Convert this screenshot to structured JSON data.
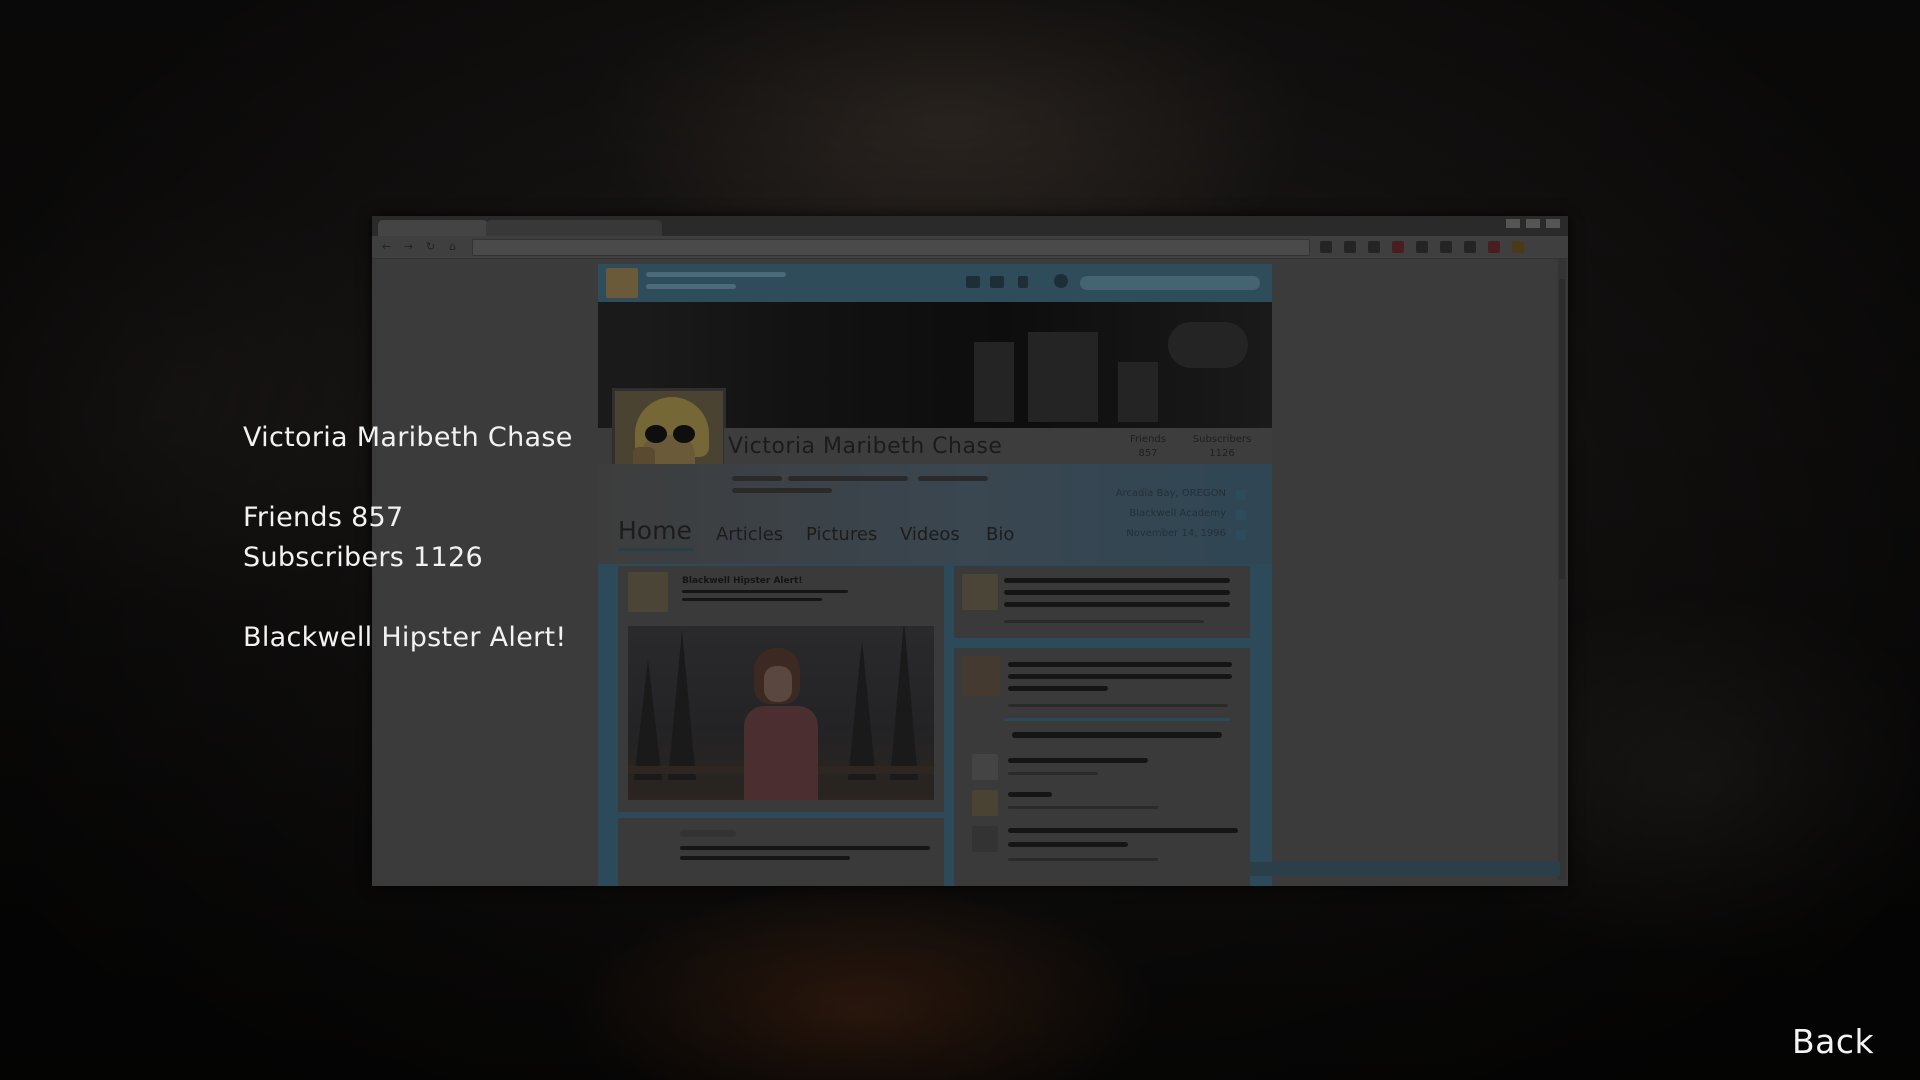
{
  "profile": {
    "name": "Victoria Maribeth Chase",
    "friends_line": "Friends 857",
    "subscribers_line": "Subscribers 1126",
    "post_title": "Blackwell Hipster Alert!"
  },
  "screenshot": {
    "page_name": "Victoria Maribeth Chase",
    "friends_label": "Friends",
    "friends_count": "857",
    "subscribers_label": "Subscribers",
    "subscribers_count": "1126",
    "info": [
      "Arcadia Bay, OREGON",
      "Blackwell Academy",
      "November 14, 1996"
    ],
    "tabs": [
      "Home",
      "Articles",
      "Pictures",
      "Videos",
      "Bio"
    ],
    "post_title": "Blackwell Hipster Alert!"
  },
  "back_label": "Back"
}
